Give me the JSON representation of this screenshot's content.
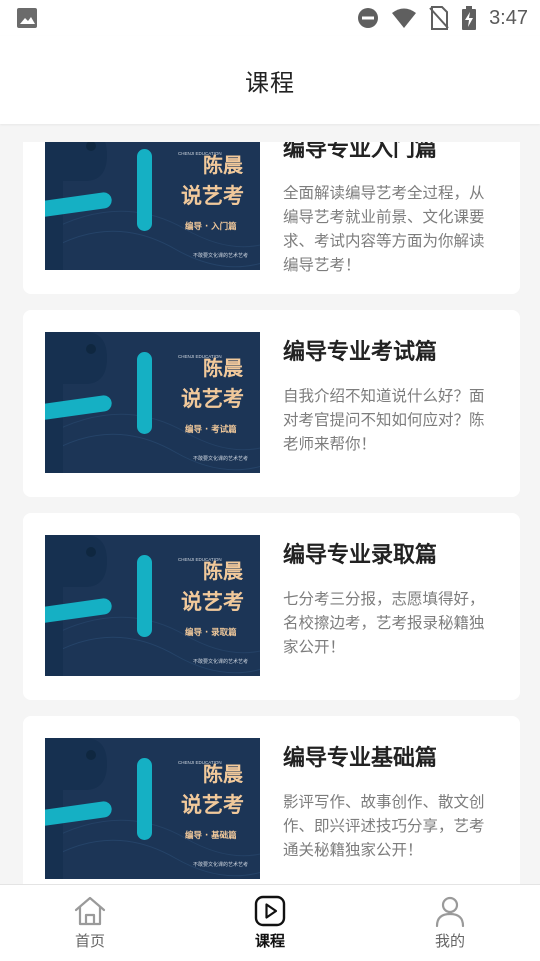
{
  "status_bar": {
    "time": "3:47",
    "icons": [
      "image-icon",
      "do-not-disturb-icon",
      "wifi-icon",
      "no-sim-icon",
      "battery-charging-icon"
    ]
  },
  "header": {
    "title": "课程"
  },
  "courses": [
    {
      "title": "编导专业入门篇",
      "description": "全面解读编导艺考全过程，从编导艺考就业前景、文化课要求、考试内容等方面为你解读编导艺考！",
      "thumb": {
        "brand": "CHENJI EDUCATION",
        "name": "陈晨",
        "headline": "说艺考",
        "subtitle": "编导 · 入门篇",
        "tagline": "不敢要文化课的艺术艺考"
      }
    },
    {
      "title": "编导专业考试篇",
      "description": "自我介绍不知道说什么好？面对考官提问不知如何应对？陈老师来帮你！",
      "thumb": {
        "brand": "CHENJI EDUCATION",
        "name": "陈晨",
        "headline": "说艺考",
        "subtitle": "编导 · 考试篇",
        "tagline": "不敢要文化课的艺术艺考"
      }
    },
    {
      "title": "编导专业录取篇",
      "description": "七分考三分报，志愿填得好，名校擦边考，艺考报录秘籍独家公开！",
      "thumb": {
        "brand": "CHENJI EDUCATION",
        "name": "陈晨",
        "headline": "说艺考",
        "subtitle": "编导 · 录取篇",
        "tagline": "不敢要文化课的艺术艺考"
      }
    },
    {
      "title": "编导专业基础篇",
      "description": "影评写作、故事创作、散文创作、即兴评述技巧分享，艺考通关秘籍独家公开！",
      "thumb": {
        "brand": "CHENJI EDUCATION",
        "name": "陈晨",
        "headline": "说艺考",
        "subtitle": "编导 · 基础篇",
        "tagline": "不敢要文化课的艺术艺考"
      }
    }
  ],
  "bottom_nav": [
    {
      "label": "首页",
      "icon": "home-icon",
      "active": false
    },
    {
      "label": "课程",
      "icon": "play-square-icon",
      "active": true
    },
    {
      "label": "我的",
      "icon": "person-icon",
      "active": false
    }
  ],
  "colors": {
    "thumb_bg": "#1c3556",
    "thumb_accent": "#15b0c4",
    "thumb_text": "#f1c99b"
  }
}
